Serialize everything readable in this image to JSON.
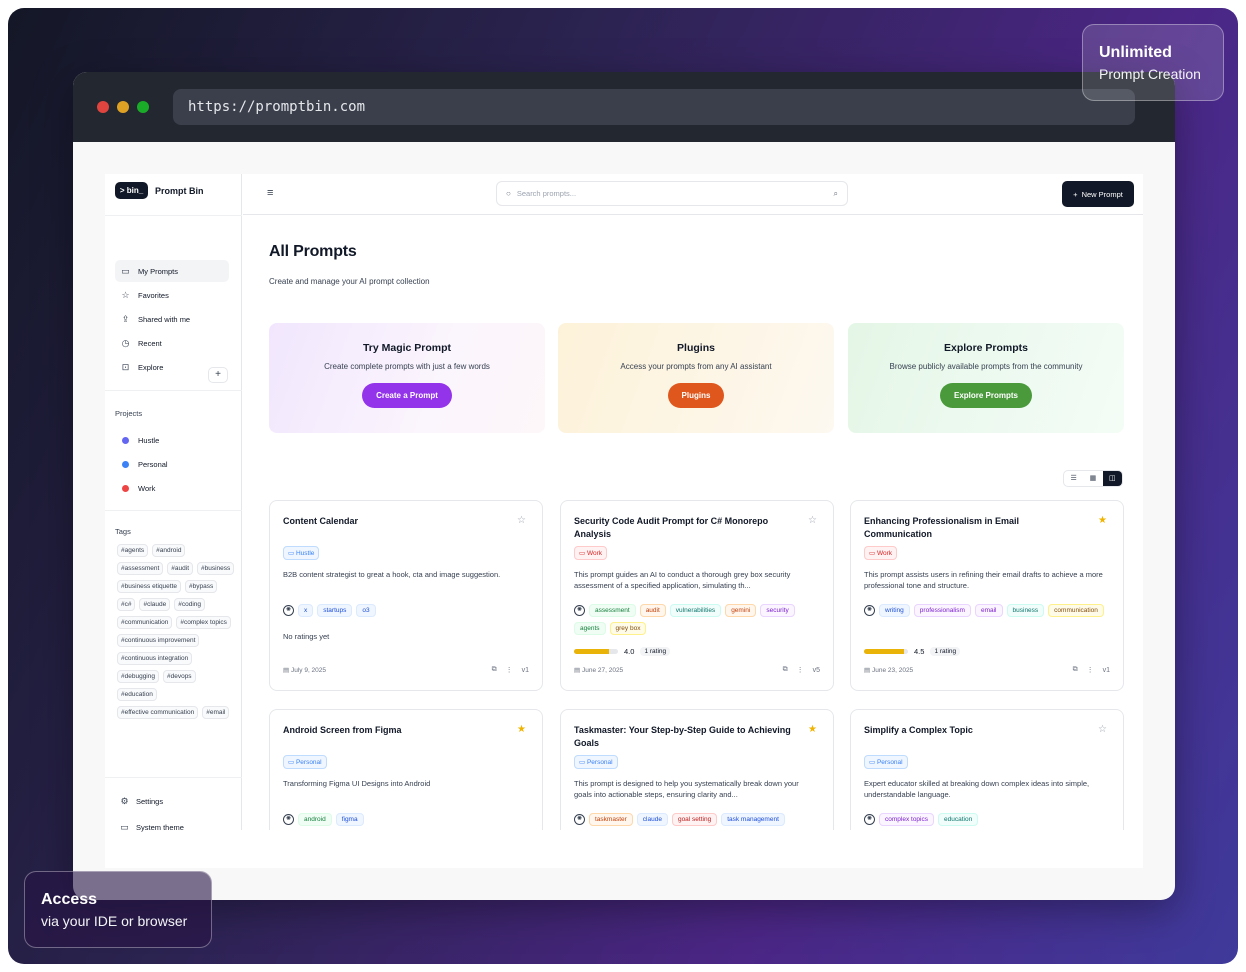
{
  "browser": {
    "url": "https://promptbin.com"
  },
  "colors": {
    "dot_red": "#e0443e",
    "dot_yellow": "#dea123",
    "dot_green": "#1aab29",
    "accent_dark": "#111827"
  },
  "brand": {
    "logo_text": "> bin_",
    "name": "Prompt Bin"
  },
  "nav": [
    {
      "label": "My Prompts",
      "icon": "folder-icon"
    },
    {
      "label": "Favorites",
      "icon": "star-icon"
    },
    {
      "label": "Shared with me",
      "icon": "share-icon"
    },
    {
      "label": "Recent",
      "icon": "clock-icon"
    },
    {
      "label": "Explore",
      "icon": "book-icon"
    }
  ],
  "projects": {
    "title": "Projects",
    "items": [
      {
        "label": "Hustle",
        "color": "#6366f1"
      },
      {
        "label": "Personal",
        "color": "#3b82f6"
      },
      {
        "label": "Work",
        "color": "#ef4444"
      }
    ]
  },
  "tags": {
    "title": "Tags",
    "items": [
      "#agents",
      "#android",
      "#assessment",
      "#audit",
      "#business",
      "#business etiquette",
      "#bypass",
      "#c#",
      "#claude",
      "#coding",
      "#communication",
      "#complex topics",
      "#continuous improvement",
      "#continuous integration",
      "#debugging",
      "#devops",
      "#education",
      "#effective communication",
      "#email"
    ]
  },
  "bottom": {
    "settings": "Settings",
    "theme": "System theme"
  },
  "topbar": {
    "search_placeholder": "Search prompts...",
    "new_prompt": "New Prompt"
  },
  "main": {
    "title": "All Prompts",
    "subtitle": "Create and manage your AI prompt collection"
  },
  "promos": [
    {
      "title": "Try Magic Prompt",
      "desc": "Create complete prompts with just a few words",
      "button": "Create a Prompt",
      "color": "#9333ea"
    },
    {
      "title": "Plugins",
      "desc": "Access your prompts from any AI assistant",
      "button": "Plugins",
      "color": "#e0571d"
    },
    {
      "title": "Explore Prompts",
      "desc": "Browse publicly available prompts from the community",
      "button": "Explore Prompts",
      "color": "#4a9a3c"
    }
  ],
  "cards": [
    {
      "title": "Content Calendar",
      "favorite": false,
      "project": "Hustle",
      "desc": "B2B content strategist to great a hook, cta and image suggestion.",
      "tags": [
        "x",
        "startups",
        "o3"
      ],
      "rating": null,
      "no_ratings": "No ratings yet",
      "date": "July 9, 2025",
      "version": "v1"
    },
    {
      "title": "Security Code Audit Prompt for C# Monorepo Analysis",
      "favorite": false,
      "project": "Work",
      "desc": "This prompt guides an AI to conduct a thorough grey box security assessment of a specified application, simulating th...",
      "tags": [
        "assessment",
        "audit",
        "vulnerabilities",
        "gemini",
        "security",
        "agents",
        "grey box"
      ],
      "rating": 4.0,
      "rating_label": "4.0",
      "rating_count": "1 rating",
      "date": "June 27, 2025",
      "version": "v5"
    },
    {
      "title": "Enhancing Professionalism in Email Communication",
      "favorite": true,
      "project": "Work",
      "desc": "This prompt assists users in refining their email drafts to achieve a more professional tone and structure.",
      "tags": [
        "writing",
        "professionalism",
        "email",
        "business",
        "communication"
      ],
      "rating": 4.5,
      "rating_label": "4.5",
      "rating_count": "1 rating",
      "date": "June 23, 2025",
      "version": "v1"
    },
    {
      "title": "Android Screen from Figma",
      "favorite": true,
      "project": "Personal",
      "desc": "Transforming Figma UI Designs into Android",
      "tags": [
        "android",
        "figma"
      ]
    },
    {
      "title": "Taskmaster: Your Step-by-Step Guide to Achieving Goals",
      "favorite": true,
      "project": "Personal",
      "desc": "This prompt is designed to help you systematically break down your goals into actionable steps, ensuring clarity and...",
      "tags": [
        "taskmaster",
        "claude",
        "goal setting",
        "task management"
      ]
    },
    {
      "title": "Simplify a Complex Topic",
      "favorite": false,
      "project": "Personal",
      "desc": "Expert educator skilled at breaking down complex ideas into simple, understandable language.",
      "tags": [
        "complex topics",
        "education"
      ]
    }
  ],
  "badges": {
    "top": {
      "line1": "Unlimited",
      "line2": "Prompt Creation"
    },
    "bottom": {
      "line1": "Access",
      "line2": "via your IDE or browser"
    }
  }
}
